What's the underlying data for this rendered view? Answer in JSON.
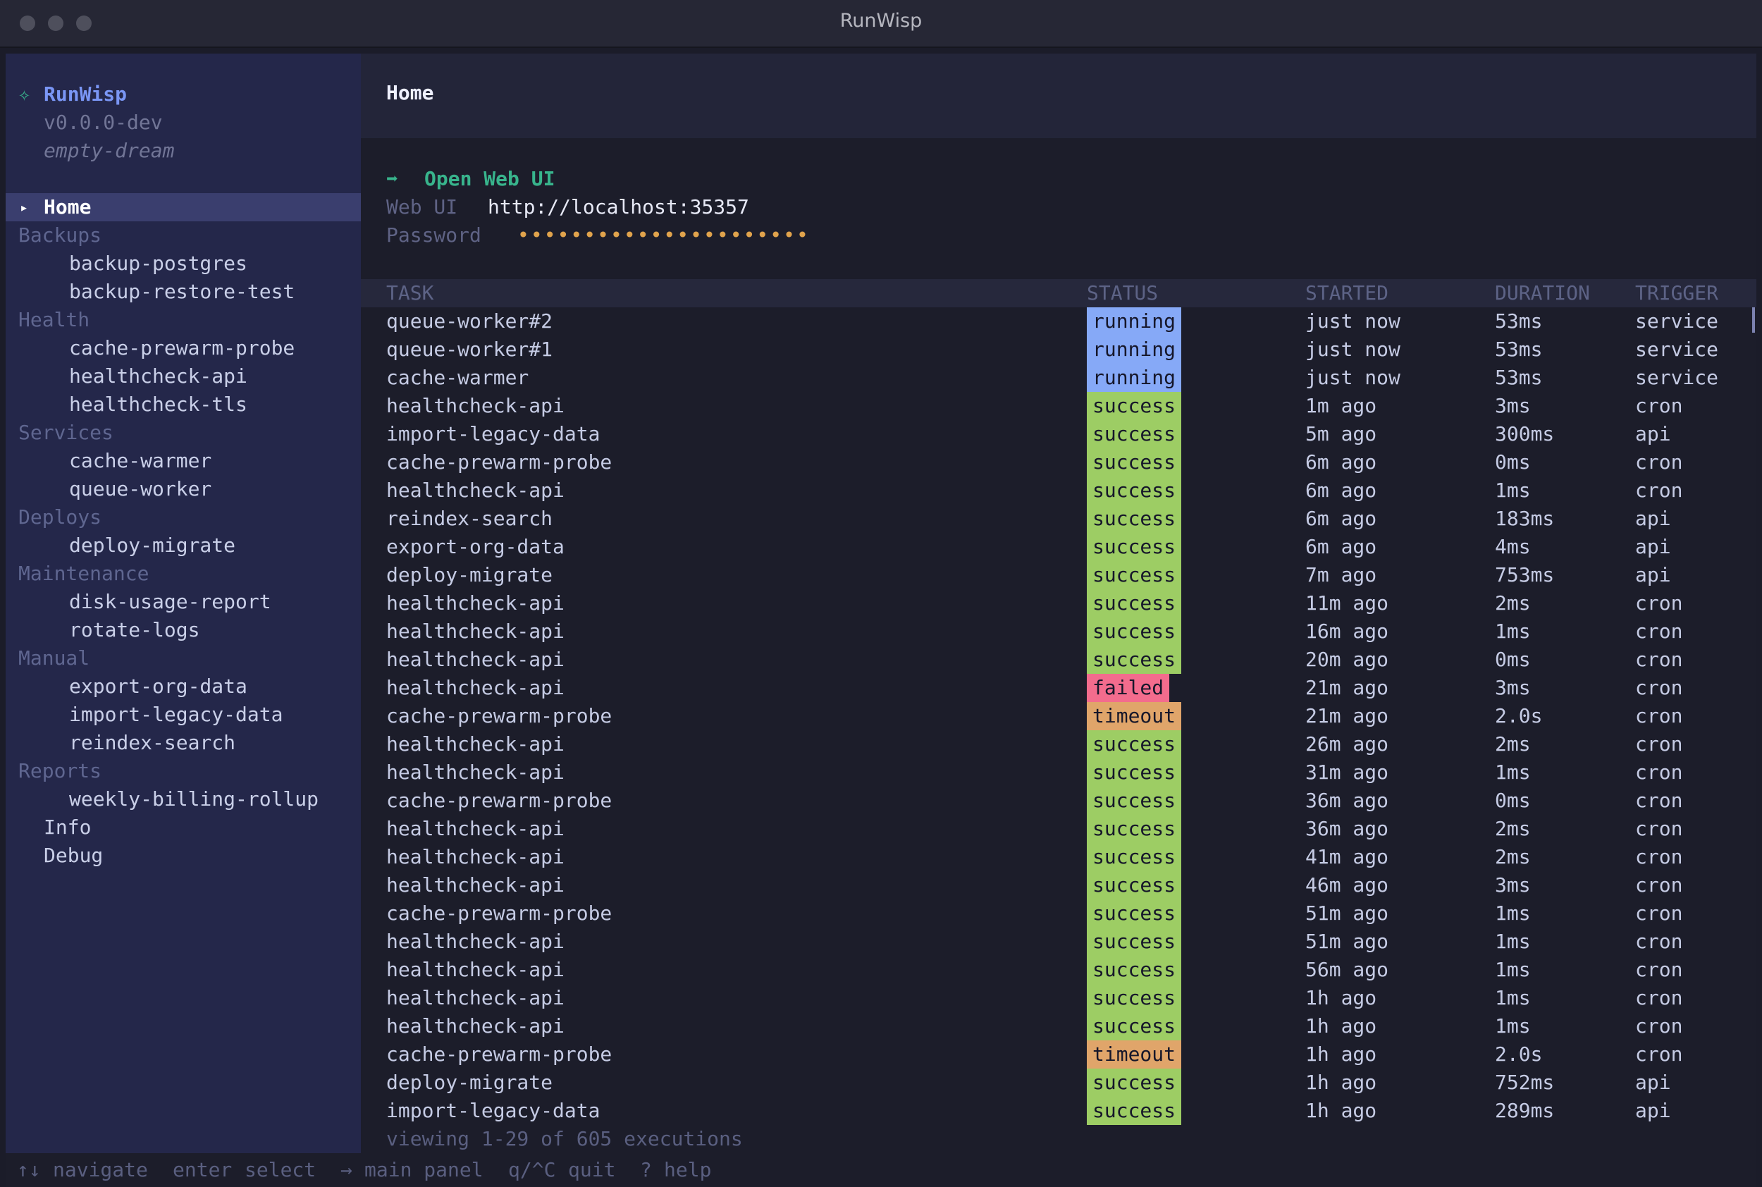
{
  "window": {
    "title": "RunWisp"
  },
  "app": {
    "name": "RunWisp",
    "version": "v0.0.0-dev",
    "instance": "empty-dream",
    "logo_glyph": "✧"
  },
  "sidebar": {
    "selected_arrow": "▸",
    "home": "Home",
    "groups": [
      {
        "label": "Backups",
        "items": [
          "backup-postgres",
          "backup-restore-test"
        ]
      },
      {
        "label": "Health",
        "items": [
          "cache-prewarm-probe",
          "healthcheck-api",
          "healthcheck-tls"
        ]
      },
      {
        "label": "Services",
        "items": [
          "cache-warmer",
          "queue-worker"
        ]
      },
      {
        "label": "Deploys",
        "items": [
          "deploy-migrate"
        ]
      },
      {
        "label": "Maintenance",
        "items": [
          "disk-usage-report",
          "rotate-logs"
        ]
      },
      {
        "label": "Manual",
        "items": [
          "export-org-data",
          "import-legacy-data",
          "reindex-search"
        ]
      },
      {
        "label": "Reports",
        "items": [
          "weekly-billing-rollup"
        ]
      }
    ],
    "extra": [
      "Info",
      "Debug"
    ]
  },
  "main": {
    "title": "Home",
    "open_web_ui": {
      "arrow": "➡",
      "label": "Open Web UI"
    },
    "web_ui_label": "Web UI",
    "web_ui_url": "http://localhost:35357",
    "password_label": "Password",
    "password_mask": "••••••••••••••••••••••"
  },
  "table": {
    "headers": {
      "task": "TASK",
      "status": "STATUS",
      "started": "STARTED",
      "duration": "DURATION",
      "trigger": "TRIGGER"
    },
    "rows": [
      {
        "task": "queue-worker#2",
        "status": "running",
        "started": "just now",
        "duration": "53ms",
        "trigger": "service"
      },
      {
        "task": "queue-worker#1",
        "status": "running",
        "started": "just now",
        "duration": "53ms",
        "trigger": "service"
      },
      {
        "task": "cache-warmer",
        "status": "running",
        "started": "just now",
        "duration": "53ms",
        "trigger": "service"
      },
      {
        "task": "healthcheck-api",
        "status": "success",
        "started": "1m ago",
        "duration": "3ms",
        "trigger": "cron"
      },
      {
        "task": "import-legacy-data",
        "status": "success",
        "started": "5m ago",
        "duration": "300ms",
        "trigger": "api"
      },
      {
        "task": "cache-prewarm-probe",
        "status": "success",
        "started": "6m ago",
        "duration": "0ms",
        "trigger": "cron"
      },
      {
        "task": "healthcheck-api",
        "status": "success",
        "started": "6m ago",
        "duration": "1ms",
        "trigger": "cron"
      },
      {
        "task": "reindex-search",
        "status": "success",
        "started": "6m ago",
        "duration": "183ms",
        "trigger": "api"
      },
      {
        "task": "export-org-data",
        "status": "success",
        "started": "6m ago",
        "duration": "4ms",
        "trigger": "api"
      },
      {
        "task": "deploy-migrate",
        "status": "success",
        "started": "7m ago",
        "duration": "753ms",
        "trigger": "api"
      },
      {
        "task": "healthcheck-api",
        "status": "success",
        "started": "11m ago",
        "duration": "2ms",
        "trigger": "cron"
      },
      {
        "task": "healthcheck-api",
        "status": "success",
        "started": "16m ago",
        "duration": "1ms",
        "trigger": "cron"
      },
      {
        "task": "healthcheck-api",
        "status": "success",
        "started": "20m ago",
        "duration": "0ms",
        "trigger": "cron"
      },
      {
        "task": "healthcheck-api",
        "status": "failed",
        "started": "21m ago",
        "duration": "3ms",
        "trigger": "cron"
      },
      {
        "task": "cache-prewarm-probe",
        "status": "timeout",
        "started": "21m ago",
        "duration": "2.0s",
        "trigger": "cron"
      },
      {
        "task": "healthcheck-api",
        "status": "success",
        "started": "26m ago",
        "duration": "2ms",
        "trigger": "cron"
      },
      {
        "task": "healthcheck-api",
        "status": "success",
        "started": "31m ago",
        "duration": "1ms",
        "trigger": "cron"
      },
      {
        "task": "cache-prewarm-probe",
        "status": "success",
        "started": "36m ago",
        "duration": "0ms",
        "trigger": "cron"
      },
      {
        "task": "healthcheck-api",
        "status": "success",
        "started": "36m ago",
        "duration": "2ms",
        "trigger": "cron"
      },
      {
        "task": "healthcheck-api",
        "status": "success",
        "started": "41m ago",
        "duration": "2ms",
        "trigger": "cron"
      },
      {
        "task": "healthcheck-api",
        "status": "success",
        "started": "46m ago",
        "duration": "3ms",
        "trigger": "cron"
      },
      {
        "task": "cache-prewarm-probe",
        "status": "success",
        "started": "51m ago",
        "duration": "1ms",
        "trigger": "cron"
      },
      {
        "task": "healthcheck-api",
        "status": "success",
        "started": "51m ago",
        "duration": "1ms",
        "trigger": "cron"
      },
      {
        "task": "healthcheck-api",
        "status": "success",
        "started": "56m ago",
        "duration": "1ms",
        "trigger": "cron"
      },
      {
        "task": "healthcheck-api",
        "status": "success",
        "started": "1h ago",
        "duration": "1ms",
        "trigger": "cron"
      },
      {
        "task": "healthcheck-api",
        "status": "success",
        "started": "1h ago",
        "duration": "1ms",
        "trigger": "cron"
      },
      {
        "task": "cache-prewarm-probe",
        "status": "timeout",
        "started": "1h ago",
        "duration": "2.0s",
        "trigger": "cron"
      },
      {
        "task": "deploy-migrate",
        "status": "success",
        "started": "1h ago",
        "duration": "752ms",
        "trigger": "api"
      },
      {
        "task": "import-legacy-data",
        "status": "success",
        "started": "1h ago",
        "duration": "289ms",
        "trigger": "api"
      }
    ],
    "footer": "viewing 1-29 of 605 executions"
  },
  "status_colors": {
    "running": "#86a9f7",
    "success": "#9dcd64",
    "failed": "#f36c8d",
    "timeout": "#e0a56a"
  },
  "helpbar": [
    {
      "key": "↑↓",
      "action": "navigate"
    },
    {
      "key": "enter",
      "action": "select"
    },
    {
      "key": "→",
      "action": "main panel"
    },
    {
      "key": "q/^C",
      "action": "quit"
    },
    {
      "key": "?",
      "action": "help"
    }
  ]
}
